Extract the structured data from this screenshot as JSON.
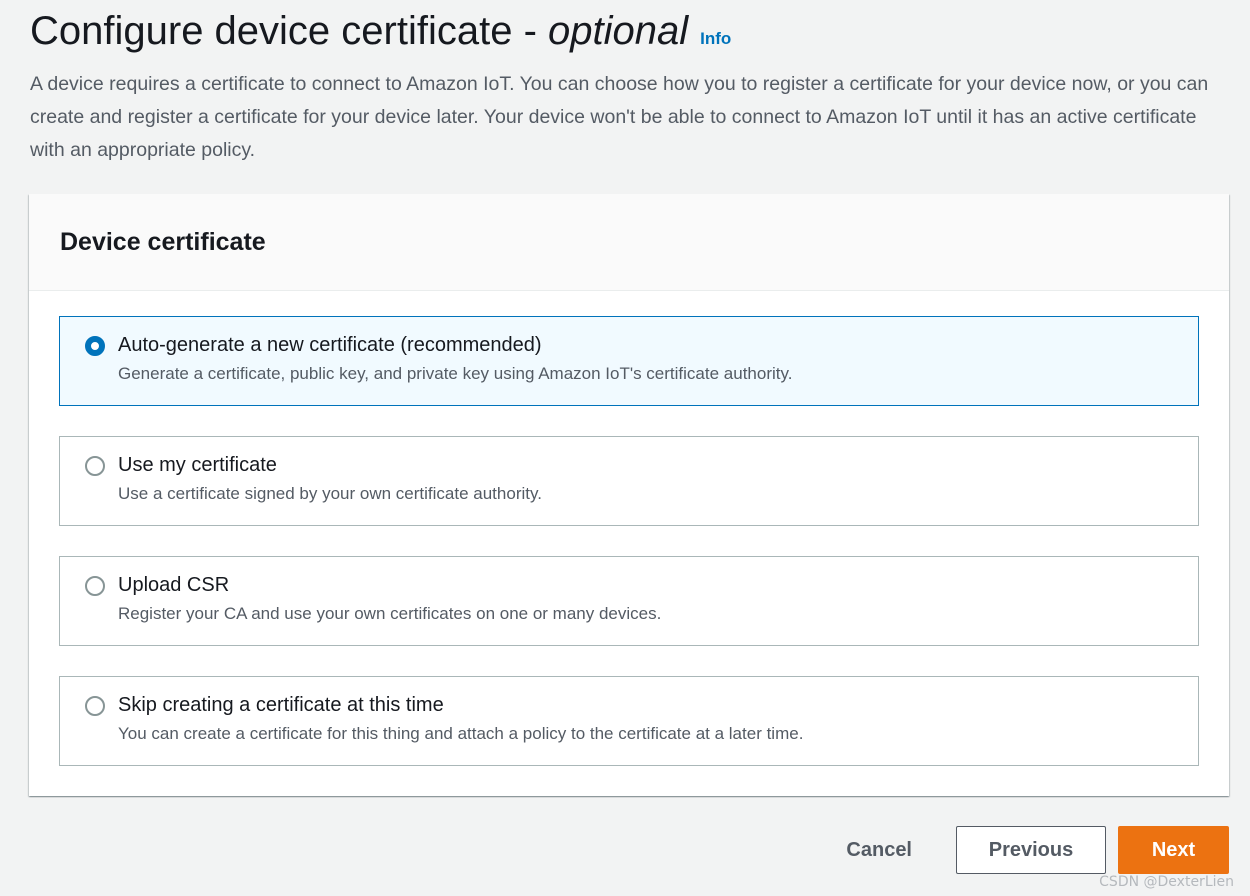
{
  "header": {
    "title_main": "Configure device certificate - ",
    "title_optional": "optional",
    "info_label": "Info",
    "description": "A device requires a certificate to connect to Amazon IoT. You can choose how you to register a certificate for your device now, or you can create and register a certificate for your device later. Your device won't be able to connect to Amazon IoT until it has an active certificate with an appropriate policy."
  },
  "certificate_panel": {
    "title": "Device certificate",
    "options": [
      {
        "label": "Auto-generate a new certificate (recommended)",
        "description": "Generate a certificate, public key, and private key using Amazon IoT's certificate authority.",
        "selected": true
      },
      {
        "label": "Use my certificate",
        "description": "Use a certificate signed by your own certificate authority.",
        "selected": false
      },
      {
        "label": "Upload CSR",
        "description": "Register your CA and use your own certificates on one or many devices.",
        "selected": false
      },
      {
        "label": "Skip creating a certificate at this time",
        "description": "You can create a certificate for this thing and attach a policy to the certificate at a later time.",
        "selected": false
      }
    ]
  },
  "actions": {
    "cancel_label": "Cancel",
    "previous_label": "Previous",
    "next_label": "Next"
  },
  "watermark": "CSDN @DexterLien",
  "colors": {
    "accent": "#0073bb",
    "primary_button": "#ec7211",
    "selected_tile_bg": "#f1faff"
  }
}
